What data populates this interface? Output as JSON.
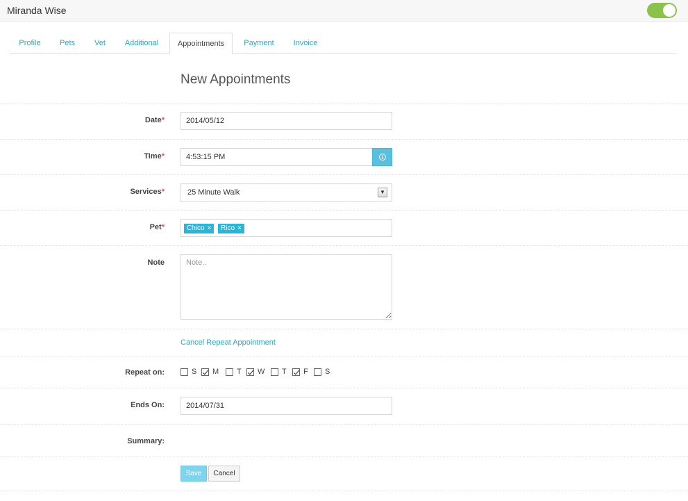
{
  "header": {
    "client_name": "Miranda Wise",
    "toggle_on": true
  },
  "tabs": [
    {
      "label": "Profile"
    },
    {
      "label": "Pets"
    },
    {
      "label": "Vet"
    },
    {
      "label": "Additional"
    },
    {
      "label": "Appointments",
      "active": true
    },
    {
      "label": "Payment"
    },
    {
      "label": "Invoice"
    }
  ],
  "form": {
    "heading": "New Appointments",
    "required_mark": "*",
    "date": {
      "label": "Date",
      "value": "2014/05/12"
    },
    "time": {
      "label": "Time",
      "value": "4:53:15 PM"
    },
    "services": {
      "label": "Services",
      "value": "25 Minute Walk"
    },
    "pet": {
      "label": "Pet",
      "tags": [
        "Chico",
        "Rico"
      ],
      "remove_glyph": "×"
    },
    "note": {
      "label": "Note",
      "placeholder": "Note.."
    },
    "cancel_repeat_link": "Cancel Repeat Appointment",
    "repeat": {
      "label": "Repeat on:",
      "days": [
        {
          "label": "S",
          "checked": false
        },
        {
          "label": "M",
          "checked": true
        },
        {
          "label": "T",
          "checked": false
        },
        {
          "label": "W",
          "checked": true
        },
        {
          "label": "T",
          "checked": false
        },
        {
          "label": "F",
          "checked": true
        },
        {
          "label": "S",
          "checked": false
        }
      ]
    },
    "ends_on": {
      "label": "Ends On:",
      "value": "2014/07/31"
    },
    "summary": {
      "label": "Summary:"
    },
    "buttons": {
      "save": "Save",
      "cancel": "Cancel"
    }
  },
  "colors": {
    "accent": "#29a9c6",
    "toggle": "#8bc34a",
    "tag": "#29b6d8",
    "required": "#e04b4b"
  },
  "icons": {
    "time_button": "clock-icon",
    "select_arrow": "chevron-down-icon"
  }
}
